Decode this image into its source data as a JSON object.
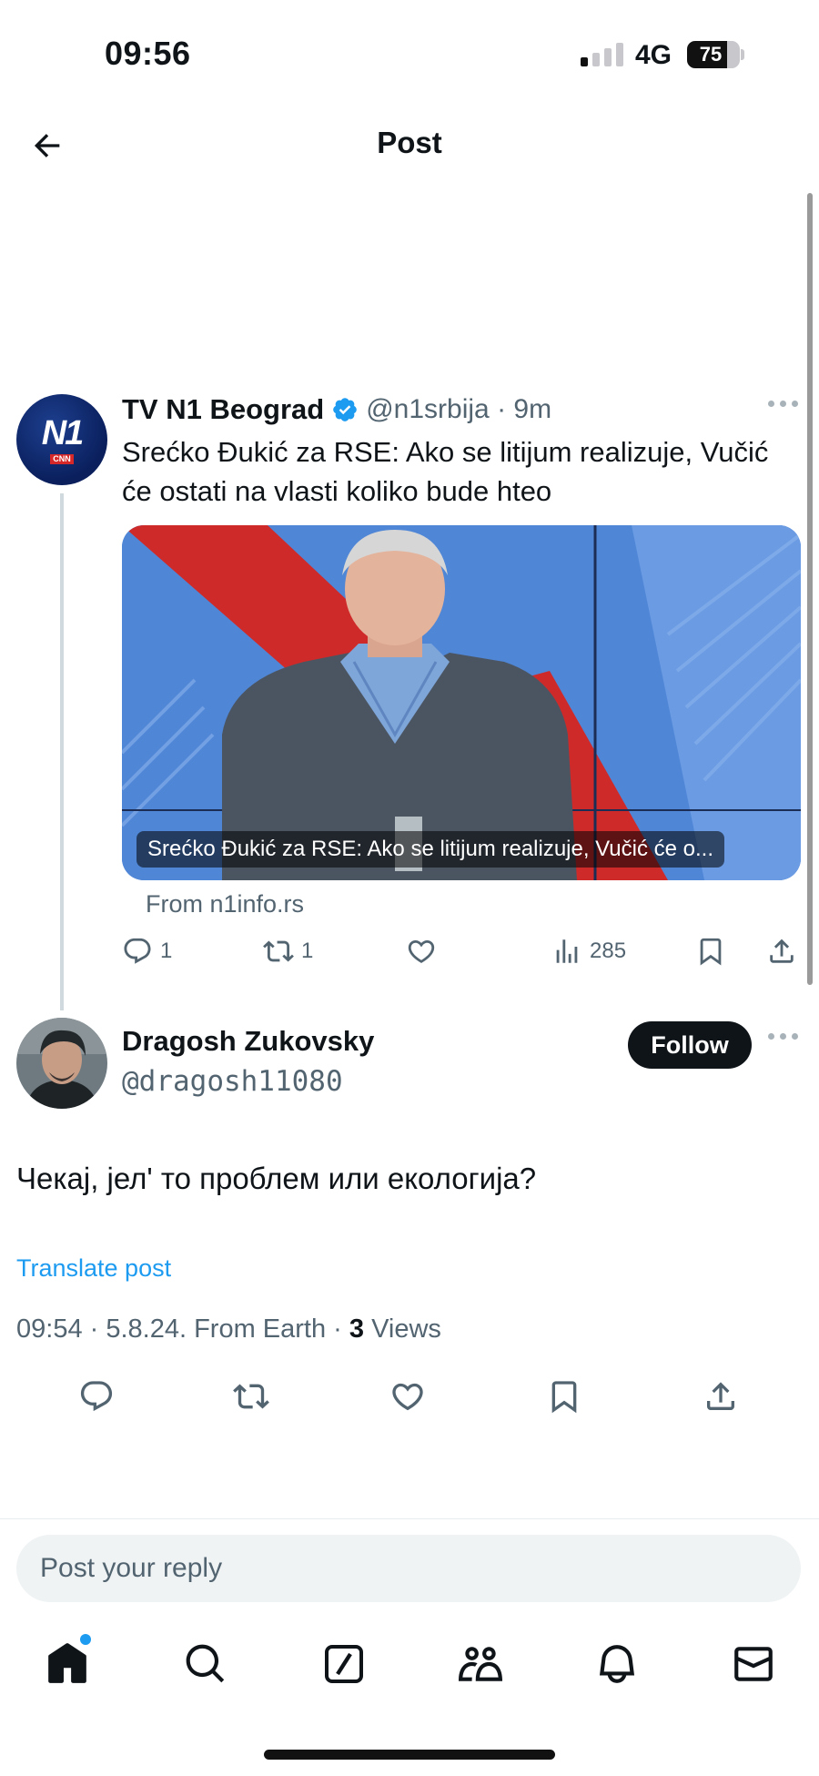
{
  "status_bar": {
    "time": "09:56",
    "network": "4G",
    "battery": "75"
  },
  "header": {
    "title": "Post"
  },
  "parent_post": {
    "author_name": "TV N1 Beograd",
    "handle": "@n1srbija",
    "time": "9m",
    "avatar_text": "N1",
    "avatar_badge": "CNN",
    "text": "Srećko Đukić za RSE: Ako se litijum realizuje, Vučić će ostati na vlasti koliko bude hteo",
    "media_caption": "Srećko Đukić za RSE: Ako se litijum realizuje, Vučić će o...",
    "source": "From n1info.rs",
    "replies": "1",
    "reposts": "1",
    "views": "285"
  },
  "reply_post": {
    "author_name": "Dragosh Zukovsky",
    "handle": "@dragosh11080",
    "follow_label": "Follow",
    "text": "Чекај, јел' то проблем или екологија?",
    "translate_label": "Translate post",
    "meta_prefix": "09:54 · 5.8.24. From Earth · ",
    "views_count": "3",
    "views_label": " Views"
  },
  "compose": {
    "placeholder": "Post your reply"
  },
  "colors": {
    "accent": "#1d9bf0",
    "text": "#0f1419",
    "secondary": "#536471"
  }
}
